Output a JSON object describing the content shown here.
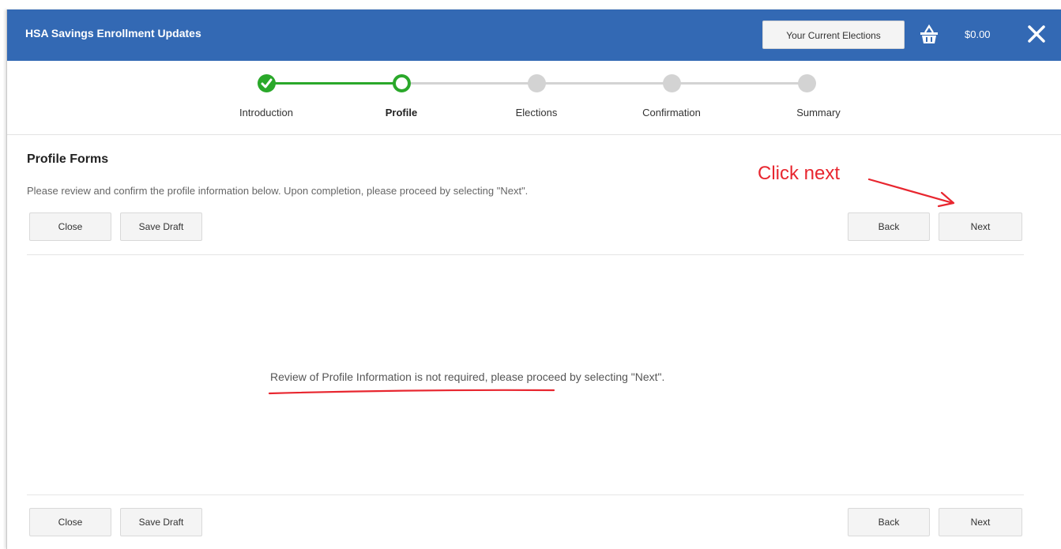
{
  "header": {
    "title": "HSA Savings Enrollment Updates",
    "current_elections_label": "Your Current Elections",
    "cart_total": "$0.00",
    "accent_color": "#3369b4"
  },
  "stepper": {
    "steps": [
      {
        "label": "Introduction",
        "state": "completed"
      },
      {
        "label": "Profile",
        "state": "current"
      },
      {
        "label": "Elections",
        "state": "pending"
      },
      {
        "label": "Confirmation",
        "state": "pending"
      },
      {
        "label": "Summary",
        "state": "pending"
      }
    ],
    "completed_color": "#2aa82a",
    "pending_color": "#d3d3d3"
  },
  "main": {
    "section_title": "Profile Forms",
    "instructions": "Please review and confirm the profile information below. Upon completion, please proceed by selecting \"Next\".",
    "message": "Review of Profile Information is not required, please proceed by selecting \"Next\"."
  },
  "actions": {
    "close_label": "Close",
    "save_draft_label": "Save Draft",
    "back_label": "Back",
    "next_label": "Next"
  },
  "annotation": {
    "text": "Click next",
    "color": "#e8262f"
  },
  "icons": {
    "basket": "basket-icon",
    "close": "close-icon",
    "check": "check-icon",
    "arrow": "arrow-annotation-icon"
  }
}
